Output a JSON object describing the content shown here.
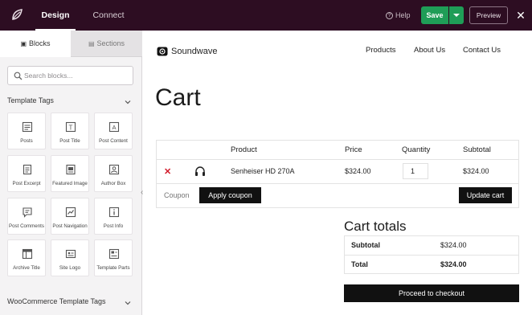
{
  "topbar": {
    "tabs": [
      {
        "label": "Design",
        "active": true
      },
      {
        "label": "Connect",
        "active": false
      }
    ],
    "help_label": "Help",
    "save_label": "Save",
    "preview_label": "Preview",
    "colors": {
      "bar": "#2d0d22",
      "save": "#1f9d57"
    }
  },
  "sidebar": {
    "tabs": [
      {
        "label": "Blocks",
        "icon": "blocks-icon",
        "active": true
      },
      {
        "label": "Sections",
        "icon": "sections-icon",
        "active": false
      }
    ],
    "search_placeholder": "Search blocks...",
    "section_title": "Template Tags",
    "blocks": [
      {
        "label": "Posts",
        "icon": "posts-icon"
      },
      {
        "label": "Post Title",
        "icon": "post-title-icon"
      },
      {
        "label": "Post Content",
        "icon": "post-content-icon"
      },
      {
        "label": "Post Excerpt",
        "icon": "post-excerpt-icon"
      },
      {
        "label": "Featured Image",
        "icon": "featured-image-icon"
      },
      {
        "label": "Author Box",
        "icon": "author-box-icon"
      },
      {
        "label": "Post Comments",
        "icon": "post-comments-icon"
      },
      {
        "label": "Post Navigation",
        "icon": "post-navigation-icon"
      },
      {
        "label": "Post Info",
        "icon": "post-info-icon"
      },
      {
        "label": "Archive Title",
        "icon": "archive-title-icon"
      },
      {
        "label": "Site Logo",
        "icon": "site-logo-icon"
      },
      {
        "label": "Template Parts",
        "icon": "template-parts-icon"
      }
    ],
    "section2_title": "WooCommerce Template Tags"
  },
  "site": {
    "brand": "Soundwave",
    "nav": [
      "Products",
      "About Us",
      "Contact Us"
    ]
  },
  "cart": {
    "title": "Cart",
    "headers": {
      "product": "Product",
      "price": "Price",
      "quantity": "Quantity",
      "subtotal": "Subtotal"
    },
    "row": {
      "product": "Senheiser HD 270A",
      "price": "$324.00",
      "quantity": "1",
      "subtotal": "$324.00"
    },
    "coupon_placeholder": "Coupon",
    "apply_label": "Apply coupon",
    "update_label": "Update cart"
  },
  "totals": {
    "title": "Cart totals",
    "subtotal_label": "Subtotal",
    "subtotal_value": "$324.00",
    "total_label": "Total",
    "total_value": "$324.00",
    "checkout_label": "Proceed to checkout"
  }
}
